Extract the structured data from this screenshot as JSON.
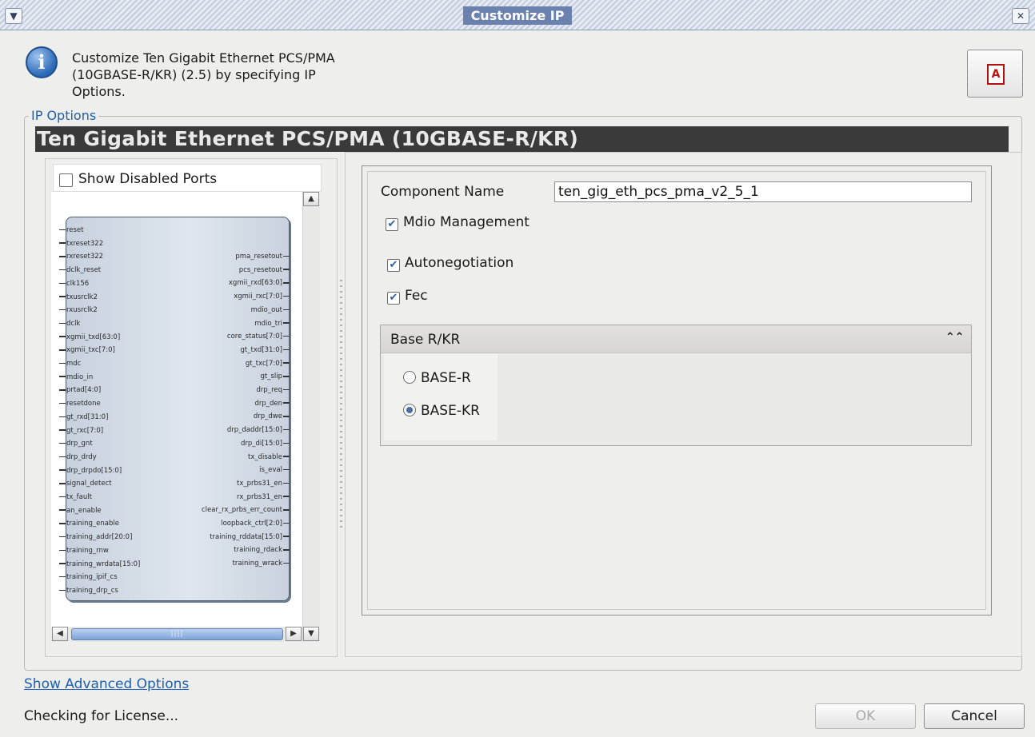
{
  "window": {
    "title": "Customize IP",
    "menu_icon": "chevron-down-icon",
    "close_icon": "close-icon"
  },
  "header": {
    "info_icon": "info-icon",
    "description": "Customize Ten Gigabit Ethernet PCS/PMA (10GBASE-R/KR) (2.5) by specifying IP Options.",
    "doc_button_icon": "pdf-icon"
  },
  "group": {
    "label": "IP Options",
    "banner": "Ten Gigabit Ethernet PCS/PMA (10GBASE-R/KR)"
  },
  "symbol_panel": {
    "show_disabled_ports": {
      "label": "Show Disabled Ports",
      "checked": false
    },
    "inputs": [
      "reset",
      "txreset322",
      "rxreset322",
      "dclk_reset",
      "clk156",
      "txusrclk2",
      "rxusrclk2",
      "dclk",
      "xgmii_txd[63:0]",
      "xgmii_txc[7:0]",
      "mdc",
      "mdio_in",
      "prtad[4:0]",
      "resetdone",
      "gt_rxd[31:0]",
      "gt_rxc[7:0]",
      "drp_gnt",
      "drp_drdy",
      "drp_drpdo[15:0]",
      "signal_detect",
      "tx_fault",
      "an_enable",
      "training_enable",
      "training_addr[20:0]",
      "training_rnw",
      "training_wrdata[15:0]",
      "training_ipif_cs",
      "training_drp_cs"
    ],
    "outputs": [
      "pma_resetout",
      "pcs_resetout",
      "xgmii_rxd[63:0]",
      "xgmii_rxc[7:0]",
      "mdio_out",
      "mdio_tri",
      "core_status[7:0]",
      "gt_txd[31:0]",
      "gt_txc[7:0]",
      "gt_slip",
      "drp_req",
      "drp_den",
      "drp_dwe",
      "drp_daddr[15:0]",
      "drp_di[15:0]",
      "tx_disable",
      "is_eval",
      "tx_prbs31_en",
      "rx_prbs31_en",
      "clear_rx_prbs_err_count",
      "loopback_ctrl[2:0]",
      "training_rddata[15:0]",
      "training_rdack",
      "training_wrack"
    ]
  },
  "config": {
    "component_name_label": "Component Name",
    "component_name_value": "ten_gig_eth_pcs_pma_v2_5_1",
    "mdio_management": {
      "label": "Mdio Management",
      "checked": true
    },
    "autonegotiation": {
      "label": "Autonegotiation",
      "checked": true
    },
    "fec": {
      "label": "Fec",
      "checked": true
    },
    "base_section": {
      "title": "Base R/KR",
      "collapse_icon": "double-chevron-up-icon",
      "options": [
        {
          "label": "BASE-R",
          "selected": false
        },
        {
          "label": "BASE-KR",
          "selected": true
        }
      ]
    }
  },
  "footer": {
    "advanced_link": "Show Advanced Options",
    "status": "Checking for License...",
    "ok_label": "OK",
    "cancel_label": "Cancel"
  }
}
